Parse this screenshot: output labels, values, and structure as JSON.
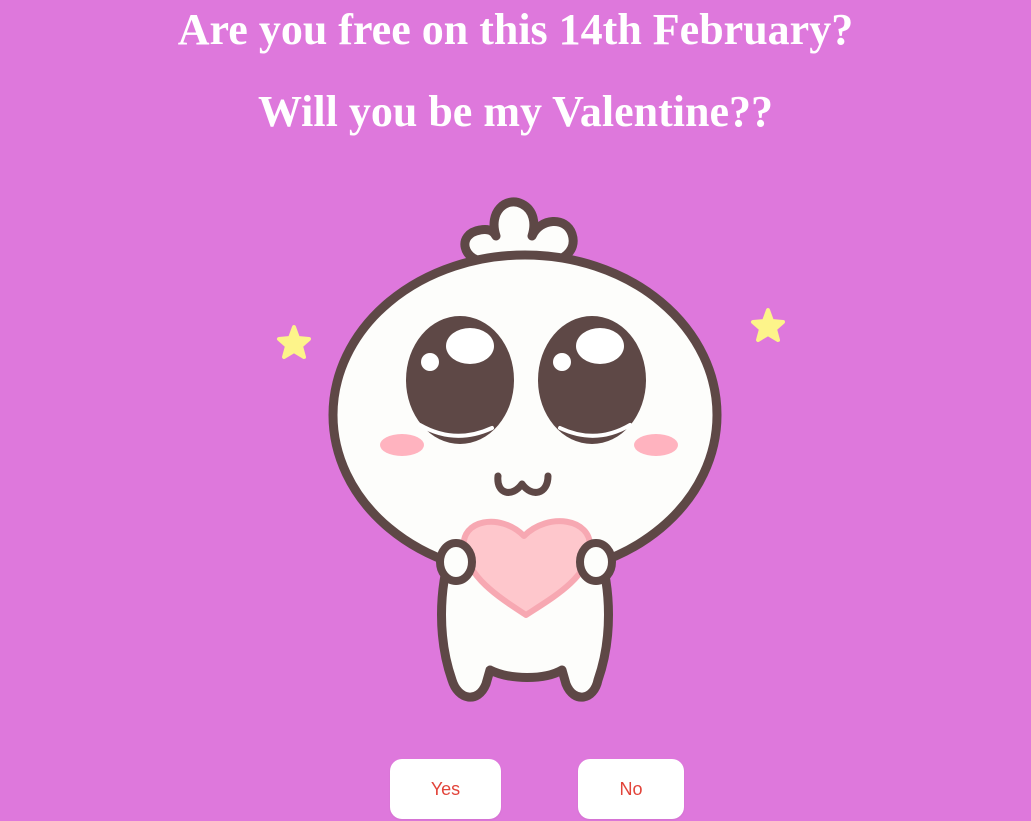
{
  "page": {
    "background_color": "#de78dc",
    "heading_line1": "Are you free on this 14th February?",
    "heading_line2": "Will you be my Valentine??"
  },
  "illustration": {
    "icon": "cute-mascot-holding-heart",
    "accent_colors": {
      "outline": "#5e4846",
      "body": "#fdfdfb",
      "heart": "#fec7cc",
      "blush": "#ffb3bf",
      "stars": "#fdf48a"
    }
  },
  "buttons": {
    "yes_label": "Yes",
    "no_label": "No",
    "text_color": "#e2443a"
  }
}
